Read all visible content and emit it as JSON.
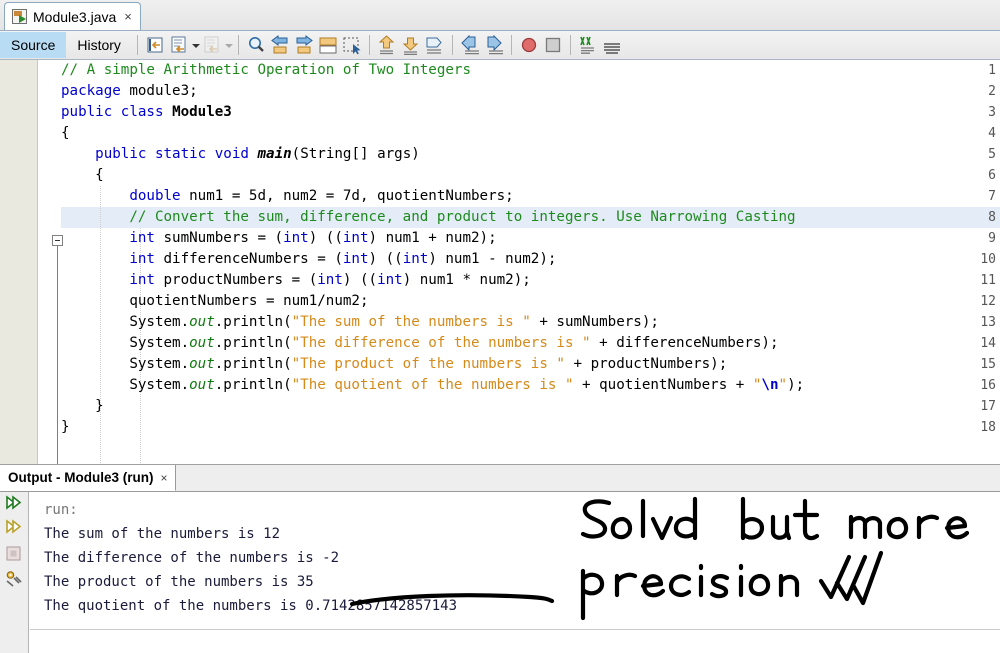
{
  "window": {
    "file_tab": {
      "label": "Module3.java",
      "close": "×",
      "icon": "java-file-icon"
    }
  },
  "toolbar": {
    "view_tabs": [
      {
        "label": "Source",
        "active": true
      },
      {
        "label": "History",
        "active": false
      }
    ],
    "buttons": [
      {
        "name": "last-edit-icon"
      },
      {
        "name": "toggle-bookmark-icon"
      },
      {
        "name": "previous-bookmark-icon"
      },
      {
        "name": "find-selection-icon"
      },
      {
        "name": "find-previous-icon"
      },
      {
        "name": "find-next-icon"
      },
      {
        "name": "toggle-highlight-icon"
      },
      {
        "name": "toggle-rectangular-selection-icon"
      },
      {
        "name": "previous-bookmark-arrow-icon"
      },
      {
        "name": "next-bookmark-arrow-icon"
      },
      {
        "name": "toggle-bookmark-flag-icon"
      },
      {
        "name": "shift-left-icon"
      },
      {
        "name": "shift-right-icon"
      },
      {
        "name": "start-macro-recording-icon"
      },
      {
        "name": "stop-macro-recording-icon"
      },
      {
        "name": "comment-icon"
      },
      {
        "name": "uncomment-icon"
      }
    ]
  },
  "editor": {
    "first_line": 1,
    "highlighted_line": 8,
    "lines": [
      {
        "n": 1,
        "html": "<span class='cm'>// A simple Arithmetic Operation of Two Integers</span>"
      },
      {
        "n": 2,
        "html": "<span class='kw'>package</span> module3;"
      },
      {
        "n": 3,
        "html": "<span class='kw'>public</span> <span class='kw'>class</span> <span class='bd'>Module3</span>"
      },
      {
        "n": 4,
        "html": "{"
      },
      {
        "n": 5,
        "html": "    <span class='kw'>public</span> <span class='kw'>static</span> <span class='kw'>void</span> <span class='bd'><i>main</i></span>(String[] args)"
      },
      {
        "n": 6,
        "html": "    {"
      },
      {
        "n": 7,
        "html": "        <span class='kw'>double</span> num1 = 5d, num2 = 7d, quotientNumbers;"
      },
      {
        "n": 8,
        "html": "        <span class='cm'>// Convert the sum, difference, and product to integers. Use Narrowing Casting</span>"
      },
      {
        "n": 9,
        "html": "        <span class='kw'>int</span> sumNumbers = (<span class='kw'>int</span>) ((<span class='kw'>int</span>) num1 + num2);"
      },
      {
        "n": 10,
        "html": "        <span class='kw'>int</span> differenceNumbers = (<span class='kw'>int</span>) ((<span class='kw'>int</span>) num1 - num2);"
      },
      {
        "n": 11,
        "html": "        <span class='kw'>int</span> productNumbers = (<span class='kw'>int</span>) ((<span class='kw'>int</span>) num1 * num2);"
      },
      {
        "n": 12,
        "html": "        quotientNumbers = num1/num2;"
      },
      {
        "n": 13,
        "html": "        System.<span class='bi'>out</span>.println(<span class='st'>\"The sum of the numbers is \"</span> + sumNumbers);"
      },
      {
        "n": 14,
        "html": "        System.<span class='bi'>out</span>.println(<span class='st'>\"The difference of the numbers is \"</span> + differenceNumbers);"
      },
      {
        "n": 15,
        "html": "        System.<span class='bi'>out</span>.println(<span class='st'>\"The product of the numbers is \"</span> + productNumbers);"
      },
      {
        "n": 16,
        "html": "        System.<span class='bi'>out</span>.println(<span class='st'>\"The quotient of the numbers is \"</span> + quotientNumbers + <span class='st'>\"</span><span class='esc'>\\n</span><span class='st'>\"</span>);"
      },
      {
        "n": 17,
        "html": "    }"
      },
      {
        "n": 18,
        "html": "}"
      }
    ],
    "plain_lines": [
      "// A simple Arithmetic Operation of Two Integers",
      "package module3;",
      "public class Module3",
      "{",
      "    public static void main(String[] args)",
      "    {",
      "        double num1 = 5d, num2 = 7d, quotientNumbers;",
      "        // Convert the sum, difference, and product to integers. Use Narrowing Casting",
      "        int sumNumbers = (int) ((int) num1 + num2);",
      "        int differenceNumbers = (int) ((int) num1 - num2);",
      "        int productNumbers = (int) ((int) num1 * num2);",
      "        quotientNumbers = num1/num2;",
      "        System.out.println(\"The sum of the numbers is \" + sumNumbers);",
      "        System.out.println(\"The difference of the numbers is \" + differenceNumbers);",
      "        System.out.println(\"The product of the numbers is \" + productNumbers);",
      "        System.out.println(\"The quotient of the numbers is \" + quotientNumbers + \"\\n\");",
      "    }",
      "}"
    ],
    "colors": {
      "keyword": "#0000d0",
      "comment": "#1e8a1e",
      "string": "#d58a1a",
      "field": "#0f7a0f",
      "highlight_row": "#e4edf7",
      "gutter_bg": "#e9e9e0"
    }
  },
  "output": {
    "tab_title": "Output - Module3 (run)",
    "tab_close": "×",
    "side_icons": [
      {
        "name": "rerun-icon"
      },
      {
        "name": "rerun-alternate-icon"
      },
      {
        "name": "stop-icon"
      },
      {
        "name": "settings-icon"
      }
    ],
    "lines": [
      {
        "text": "run:",
        "muted": true
      },
      {
        "text": "The sum of the numbers is 12",
        "muted": false
      },
      {
        "text": "The difference of the numbers is -2",
        "muted": false
      },
      {
        "text": "The product of the numbers is 35",
        "muted": false
      },
      {
        "text": "The quotient of the numbers is 0.7142857142857143",
        "muted": false
      }
    ]
  },
  "annotation": {
    "line1": "Solved but more",
    "line2": "precision",
    "marks": "✓✓✓",
    "underline": "hand-drawn-underline-under-quotient-value",
    "ink_color": "#000000"
  }
}
